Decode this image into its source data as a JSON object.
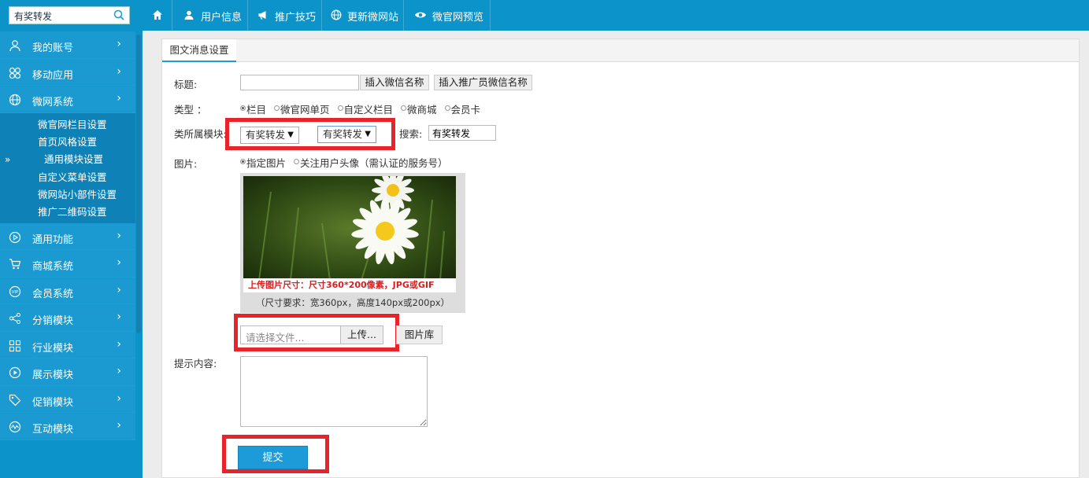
{
  "sidebar": {
    "search_value": "有奖转发",
    "items": [
      {
        "label": "我的账号",
        "icon": "user-icon"
      },
      {
        "label": "移动应用",
        "icon": "apps-icon"
      },
      {
        "label": "微网系统",
        "icon": "globe-icon"
      },
      {
        "label": "通用功能",
        "icon": "play-icon"
      },
      {
        "label": "商城系统",
        "icon": "cart-icon"
      },
      {
        "label": "会员系统",
        "icon": "vip-icon"
      },
      {
        "label": "分销模块",
        "icon": "share-icon"
      },
      {
        "label": "行业模块",
        "icon": "grid-icon"
      },
      {
        "label": "展示模块",
        "icon": "display-icon"
      },
      {
        "label": "促销模块",
        "icon": "tag-icon"
      },
      {
        "label": "互动模块",
        "icon": "wave-icon"
      }
    ],
    "submenu": [
      "微官网栏目设置",
      "首页风格设置",
      "通用模块设置",
      "自定义菜单设置",
      "微网站小部件设置",
      "推广二维码设置"
    ],
    "active_marker": "»",
    "chevron": "›"
  },
  "topnav": {
    "items": [
      {
        "label": "用户信息",
        "icon": "user-icon"
      },
      {
        "label": "推广技巧",
        "icon": "megaphone-icon"
      },
      {
        "label": "更新微网站",
        "icon": "globe-icon"
      },
      {
        "label": "微官网预览",
        "icon": "eye-icon"
      }
    ]
  },
  "panel": {
    "tab": "图文消息设置",
    "title_label": "标题:",
    "title_value": "",
    "insert_wechat_name": "插入微信名称",
    "insert_promoter_name": "插入推广员微信名称",
    "type_label": "类型 ：",
    "type_options": [
      {
        "label": "栏目",
        "checked": true
      },
      {
        "label": "微官网单页",
        "checked": false
      },
      {
        "label": "自定义栏目",
        "checked": false
      },
      {
        "label": "微商城",
        "checked": false
      },
      {
        "label": "会员卡",
        "checked": false
      }
    ],
    "module_label": "类所属模块:",
    "select1": "有奖转发",
    "select2": "有奖转发",
    "search_label": "搜索:",
    "search_value": "有奖转发",
    "image_label": "图片:",
    "image_options": [
      {
        "label": "指定图片",
        "checked": true
      },
      {
        "label": "关注用户头像（需认证的服务号）",
        "checked": false
      }
    ],
    "photo_caption": "上传图片尺寸：尺寸360*200像素，JPG或GIF",
    "size_note": "（尺寸要求：宽360px，高度140px或200px）",
    "file_placeholder": "请选择文件...",
    "upload_btn": "上传...",
    "gallery_btn": "图片库",
    "tip_label": "提示内容:",
    "tip_value": "",
    "submit": "提交"
  }
}
